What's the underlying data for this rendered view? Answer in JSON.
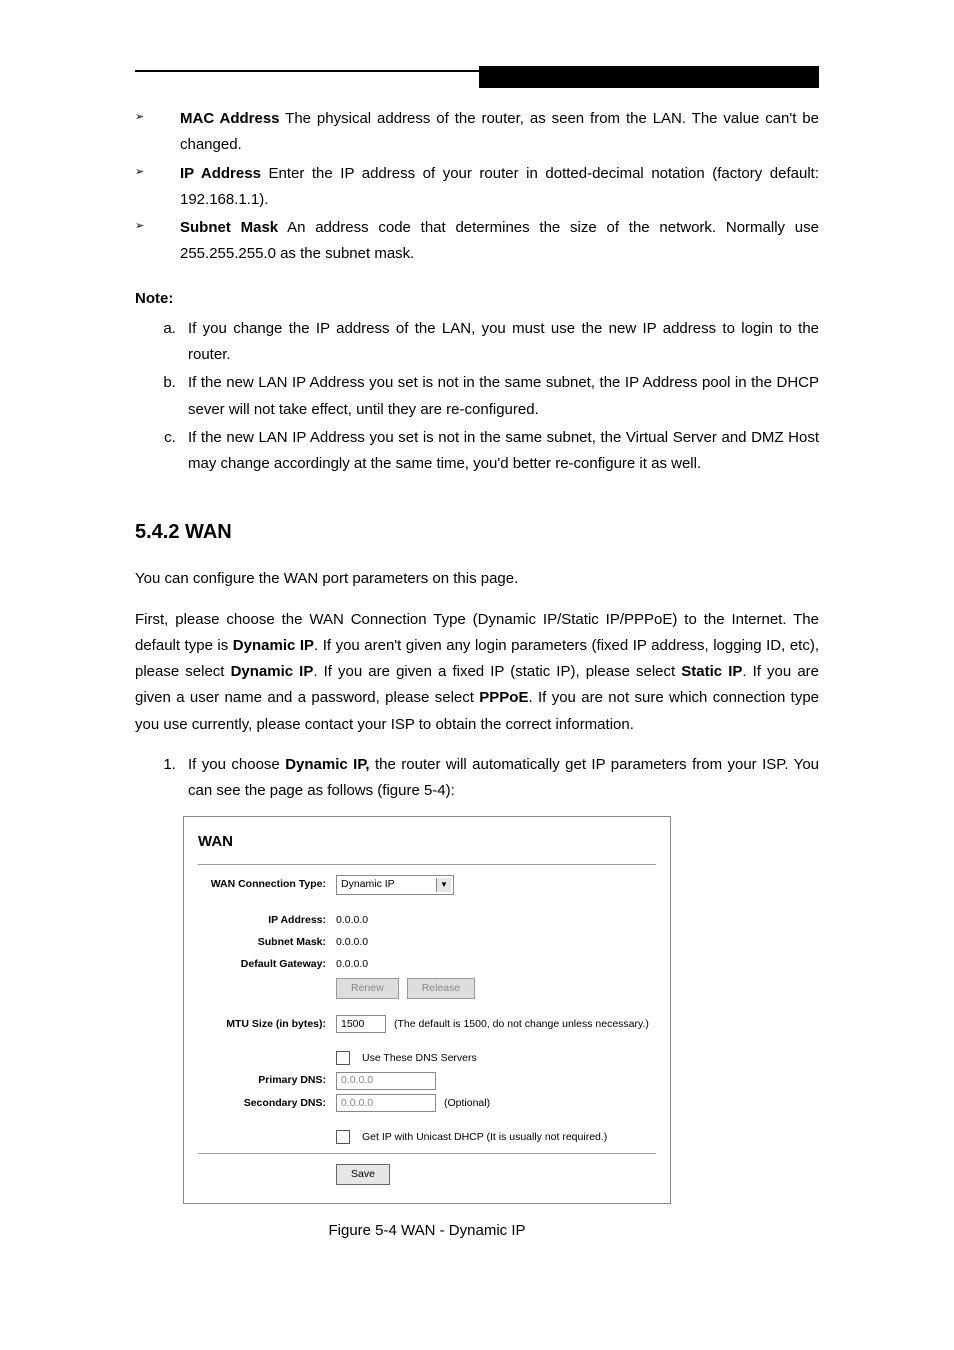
{
  "header_bar": "",
  "bullets": [
    {
      "term": "MAC Address",
      "sep": " - ",
      "text": "The physical address of the router, as seen from the LAN. The value can't be changed."
    },
    {
      "term": "IP Address",
      "sep": " - ",
      "text": "Enter the IP address of your router in dotted-decimal notation (factory default: 192.168.1.1)."
    },
    {
      "term": "Subnet Mask",
      "sep": " - ",
      "text": "An address code that determines the size of the network. Normally use 255.255.255.0 as the subnet mask."
    }
  ],
  "note_label": "Note:",
  "notes": [
    "If you change the IP address of the LAN, you must use the new IP address to login to the router.",
    "If the new LAN IP Address you set is not in the same subnet, the IP Address pool in the DHCP sever will not take effect, until they are re-configured.",
    "If the new LAN IP Address you set is not in the same subnet, the Virtual Server and DMZ Host may change accordingly at the same time, you'd better re-configure it as well."
  ],
  "section_title": "5.4.2 WAN",
  "para1": "You can configure the WAN port parameters on this page.",
  "para2_parts": {
    "a": "First, please choose the WAN Connection Type (Dynamic IP/Static IP/PPPoE) to the Internet. The default type is ",
    "b": "Dynamic IP",
    "c": ". If you aren't given any login parameters (fixed IP address, logging ID, etc), please select ",
    "d": "Dynamic IP",
    "e": ". If you are given a fixed IP (static IP), please select ",
    "f": "Static IP",
    "g": ". If you are given a user name and a password, please select ",
    "h": "PPPoE",
    "i": ". If you are not sure which connection type you use currently, please contact your ISP to obtain the correct information."
  },
  "numlist_1": {
    "a": "If you choose ",
    "b": "Dynamic IP,",
    "c": " the router will automatically get IP parameters from your ISP. You can see the page as follows (figure 5-4):"
  },
  "wan": {
    "title": "WAN",
    "rows": {
      "conn_type_label": "WAN Connection Type:",
      "conn_type_value": "Dynamic IP",
      "ip_label": "IP Address:",
      "ip_value": "0.0.0.0",
      "mask_label": "Subnet Mask:",
      "mask_value": "0.0.0.0",
      "gw_label": "Default Gateway:",
      "gw_value": "0.0.0.0",
      "renew": "Renew",
      "release": "Release",
      "mtu_label": "MTU Size (in bytes):",
      "mtu_value": "1500",
      "mtu_hint": "(The default is 1500, do not change unless necessary.)",
      "use_dns": "Use These DNS Servers",
      "pdns_label": "Primary DNS:",
      "pdns_value": "0.0.0.0",
      "sdns_label": "Secondary DNS:",
      "sdns_value": "0.0.0.0",
      "optional": "(Optional)",
      "unicast": "Get IP with Unicast DHCP (It is usually not required.)",
      "save": "Save"
    }
  },
  "figure_caption": "Figure 5-4    WAN - Dynamic IP"
}
